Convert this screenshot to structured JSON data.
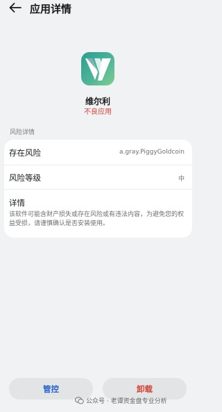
{
  "header": {
    "title": "应用详情",
    "back_icon": "arrow-left-icon"
  },
  "app": {
    "icon": "app-logo-icon",
    "name": "维尔利",
    "tag": "不良应用",
    "tag_color": "#d0453a"
  },
  "risk": {
    "section_label": "风险详情",
    "rows": [
      {
        "label": "存在风险",
        "value": "a.gray.PiggyGoldcoin"
      },
      {
        "label": "风险等级",
        "value": "中"
      }
    ],
    "detail_label": "详情",
    "detail_text": "该软件可能含财产损失或存在风险或有违法内容，为避免您的权益受损，请谨慎确认是否安装使用。"
  },
  "actions": {
    "manage_label": "管控",
    "uninstall_label": "卸载",
    "manage_color": "#2962c8",
    "uninstall_color": "#d0453a"
  },
  "watermark": {
    "text": "公众号 · 老谭资金盘专业分析",
    "icon": "wechat-icon"
  }
}
